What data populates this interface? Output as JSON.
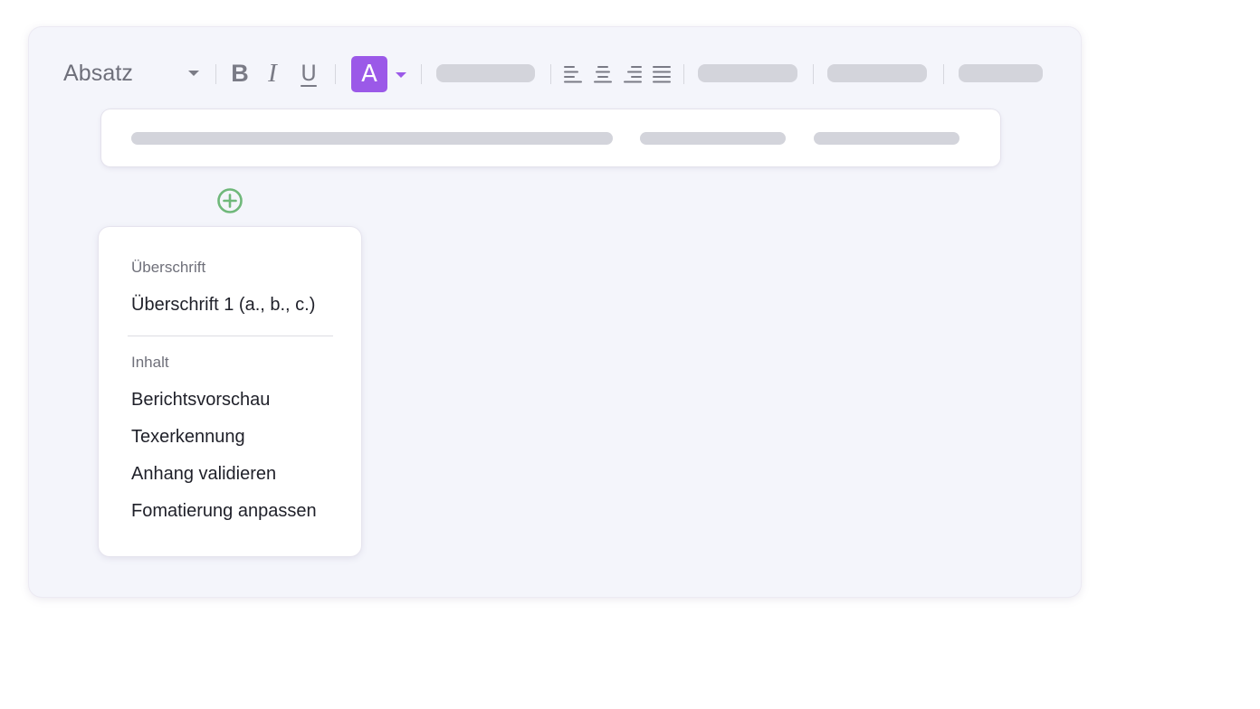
{
  "toolbar": {
    "paragraph_style": "Absatz",
    "bold_glyph": "B",
    "italic_glyph": "I",
    "underline_glyph": "U",
    "text_color_glyph": "A",
    "text_color": "#9b59e8"
  },
  "add_button": {
    "icon": "plus-circle-icon",
    "color": "#6fb87a"
  },
  "insert_menu": {
    "sections": [
      {
        "heading": "Überschrift",
        "items": [
          "Überschrift 1 (a., b., c.)"
        ]
      },
      {
        "heading": "Inhalt",
        "items": [
          "Berichtsvorschau",
          "Texerkennung",
          "Anhang validieren",
          "Fomatierung anpassen"
        ]
      }
    ]
  }
}
